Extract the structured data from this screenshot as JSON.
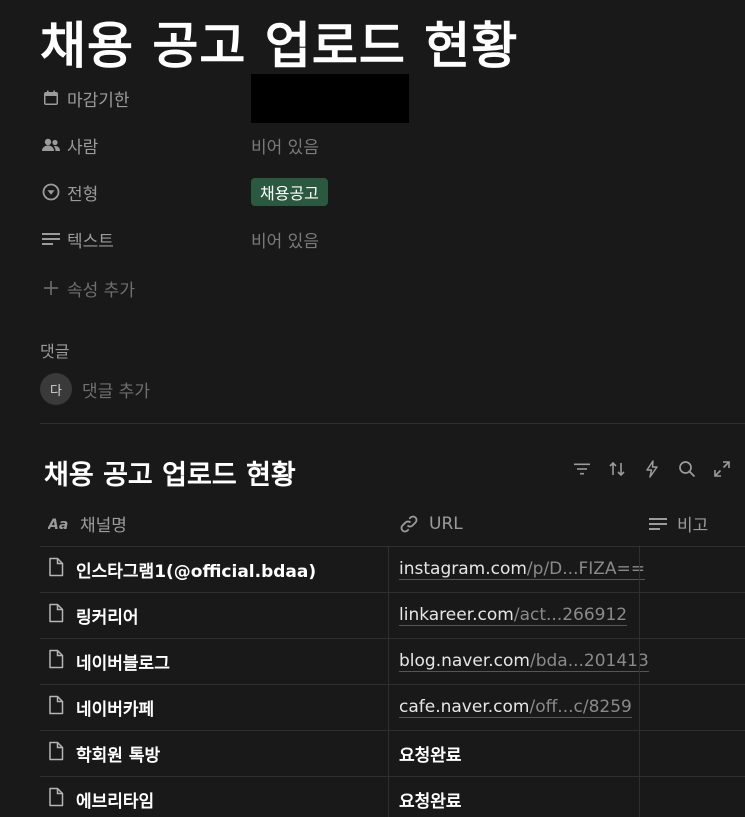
{
  "page": {
    "title": "채용 공고 업로드 현황"
  },
  "properties": {
    "deadline": {
      "label": "마감기한",
      "icon": "calendar-icon"
    },
    "people": {
      "label": "사람",
      "value": "비어 있음",
      "icon": "people-icon"
    },
    "type": {
      "label": "전형",
      "value": "채용공고",
      "icon": "select-circle-icon",
      "tag_color": "#2b593f"
    },
    "text": {
      "label": "텍스트",
      "value": "비어 있음",
      "icon": "text-lines-icon"
    },
    "add_label": "속성 추가"
  },
  "comments": {
    "heading": "댓글",
    "avatar_letter": "다",
    "placeholder": "댓글 추가"
  },
  "database": {
    "title": "채용 공고 업로드 현황",
    "tools": [
      "filter-icon",
      "sort-icon",
      "automation-bolt-icon",
      "search-icon",
      "expand-icon"
    ],
    "columns": [
      {
        "label": "채널명",
        "icon": "title-aa-icon"
      },
      {
        "label": "URL",
        "icon": "link-icon"
      },
      {
        "label": "비고",
        "icon": "text-lines-icon"
      }
    ],
    "rows": [
      {
        "name": "인스타그램1(@official.bdaa)",
        "url_host": "instagram.com",
        "url_rest": "/p/D...FIZA==",
        "note": ""
      },
      {
        "name": "링커리어",
        "url_host": "linkareer.com",
        "url_rest": "/act...266912",
        "note": ""
      },
      {
        "name": "네이버블로그",
        "url_host": "blog.naver.com",
        "url_rest": "/bda...201413",
        "note": ""
      },
      {
        "name": "네이버카페",
        "url_host": "cafe.naver.com",
        "url_rest": "/off...c/8259",
        "note": ""
      },
      {
        "name": "학회원 톡방",
        "url_plain": "요청완료",
        "note": ""
      },
      {
        "name": "에브리타임",
        "url_plain": "요청완료",
        "note": ""
      }
    ]
  }
}
